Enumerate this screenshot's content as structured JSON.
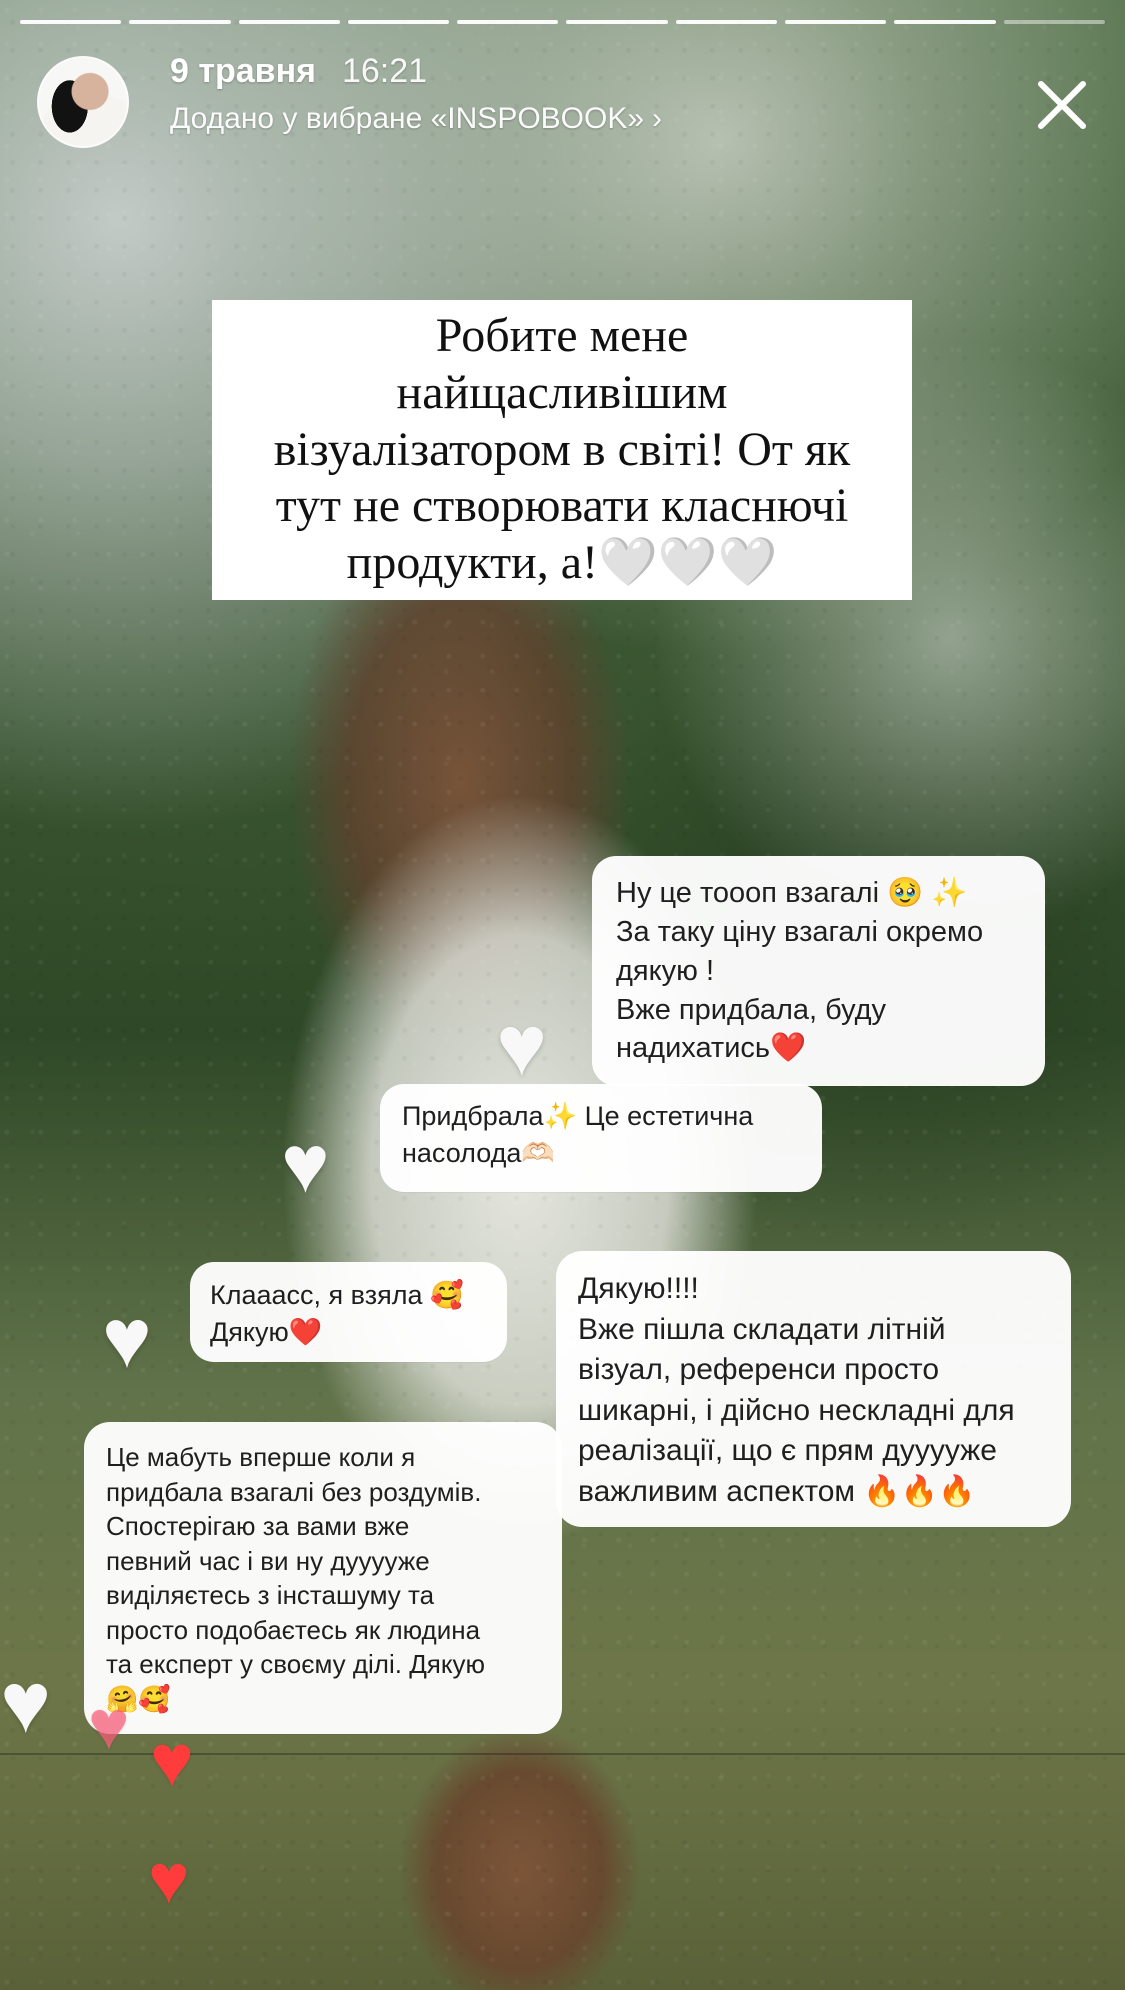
{
  "header": {
    "date": "9 травня",
    "time": "16:21",
    "favorite_text": "Додано у вибране «INSPOBOOK»",
    "favorite_chevron": "›"
  },
  "progress": {
    "total_segments": 10,
    "completed_segments": 9
  },
  "controls": {
    "close_icon": "close-icon"
  },
  "story": {
    "title": "Робите мене\nнайщасливішим\nвізуалізатором в світі! От як\nтут не створювати класнючі\nпродукти, а!🤍🤍🤍"
  },
  "messages": [
    {
      "text": "Ну це тоооп взагалі 🥹 ✨\nЗа таку ціну взагалі окремо\nдякую !\nВже придбала, буду\nнадихатись❤️"
    },
    {
      "text": "Придбрала✨ Це естетична\nнасолода🫶🏻"
    },
    {
      "text": "Клааасс, я взяла 🥰\nДякую❤️"
    },
    {
      "text": "Дякую!!!!\nВже пішла складати літній\nвізуал, референси просто\nшикарні, і дійсно нескладні для\nреалізації, що є прям дууууже\nважливим аспектом 🔥🔥🔥"
    },
    {
      "text": "Це мабуть вперше коли я\nпридбала взагалі без роздумів.\nСпостерігаю за вами вже\nпевний час і ви ну дууууже\nвиділяєтесь з інсташуму та\nпросто подобаєтесь як людина\nта експерт у своєму ділі. Дякую\n🤗🥰"
    }
  ],
  "reactions": {
    "white_heart_icon": "white-heart-icon",
    "red_heart_icon": "red-heart-icon"
  },
  "colors": {
    "text_primary": "#1f1f1f",
    "white": "#ffffff",
    "heart_red": "#ff3b3b"
  }
}
